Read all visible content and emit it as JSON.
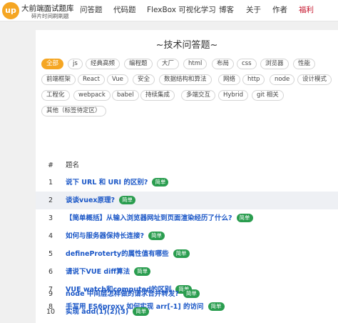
{
  "header": {
    "logo_text": "up",
    "brand_title": "大前端面试题库",
    "brand_subtitle": "碎片时间刷刷题",
    "nav": [
      "问答题",
      "代码题",
      "FlexBox 可视化学习",
      "博客",
      "关于",
      "作者",
      "福利"
    ],
    "active_nav": "福利",
    "accent_color": "#c6162d"
  },
  "page": {
    "title": "~技术问答题~",
    "tags": [
      "全部",
      "js",
      "经典高频",
      "编程题",
      "大厂",
      "html",
      "布局",
      "css",
      "浏览器",
      "性能",
      "前端框架",
      "React",
      "Vue",
      "安全",
      "数据结构和算法",
      "网络",
      "http",
      "node",
      "设计模式",
      "工程化",
      "webpack",
      "babel",
      "持续集成",
      "多端交互",
      "Hybrid",
      "git 相关",
      "其他（标签待定区）"
    ],
    "active_tag": "全部",
    "tag_active_color": "#f5a623"
  },
  "table": {
    "headers": {
      "num": "#",
      "title": "题名"
    },
    "badge_color": "#2a9d4f",
    "rows": [
      {
        "num": "1",
        "title": "说下 URL 和 URI 的区别?",
        "badge": "简单"
      },
      {
        "num": "2",
        "title": "谈谈vuex原理?",
        "badge": "简单"
      },
      {
        "num": "3",
        "title": "【简单概括】从输入浏览器网址到页面渲染经历了什么?",
        "badge": "简单"
      },
      {
        "num": "4",
        "title": "如何与服务器保持长连接?",
        "badge": "简单"
      },
      {
        "num": "5",
        "title": "defineProterty的属性值有哪些",
        "badge": "简单"
      },
      {
        "num": "6",
        "title": "请说下VUE diff算法",
        "badge": "简单"
      },
      {
        "num": "7",
        "title": "VUE watch和computed的区别",
        "badge": "简单"
      },
      {
        "num": "8",
        "title": "手写用 ES6proxy 如何实现 arr[-1] 的访问",
        "badge": "简单"
      },
      {
        "num": "9",
        "title": "node 中间层怎样做的请求合并转发?",
        "badge": "简单"
      },
      {
        "num": "10",
        "title": "实现 add(1)(2)(3)",
        "badge": "简单"
      }
    ]
  }
}
